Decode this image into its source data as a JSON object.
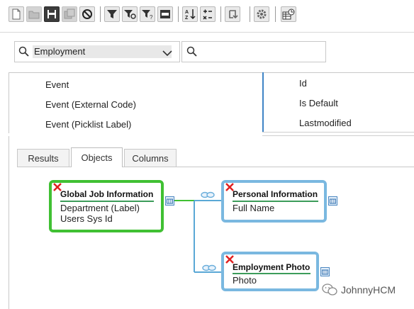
{
  "toolbar": {
    "buttons": [
      {
        "name": "new-icon"
      },
      {
        "name": "open-folder-icon"
      },
      {
        "name": "save-icon"
      },
      {
        "name": "save-as-icon"
      },
      {
        "name": "cancel-icon"
      },
      {
        "name": "filter-icon"
      },
      {
        "name": "filter-settings-icon"
      },
      {
        "name": "filter-question-icon"
      },
      {
        "name": "text-box-icon"
      },
      {
        "name": "sort-ascending-icon"
      },
      {
        "name": "calculation-icon"
      },
      {
        "name": "refresh-icon"
      },
      {
        "name": "settings-icon"
      },
      {
        "name": "report-grid-icon"
      }
    ]
  },
  "search": {
    "entity_value": "Employment"
  },
  "fields": {
    "left": [
      "Event",
      "Event (External Code)",
      "Event (Picklist Label)"
    ],
    "right": [
      "Id",
      "Is Default",
      "Lastmodified"
    ]
  },
  "tabs": [
    {
      "label": "Results",
      "active": false
    },
    {
      "label": "Objects",
      "active": true
    },
    {
      "label": "Columns",
      "active": false
    }
  ],
  "diagram": {
    "primary": {
      "title": "Global Job Information",
      "fields": [
        "Department (Label)",
        "Users Sys Id"
      ]
    },
    "related": [
      {
        "title": "Personal Information",
        "fields": [
          "Full Name"
        ]
      },
      {
        "title": "Employment Photo",
        "fields": [
          "Photo"
        ]
      }
    ]
  },
  "watermark": {
    "text": "JohnnyHCM"
  },
  "colors": {
    "primary_border": "#40c033",
    "related_border": "#7ab8e0",
    "connector": "#5aa8d6",
    "divider_accent": "#3f84c6",
    "remove_x": "#e02020"
  }
}
